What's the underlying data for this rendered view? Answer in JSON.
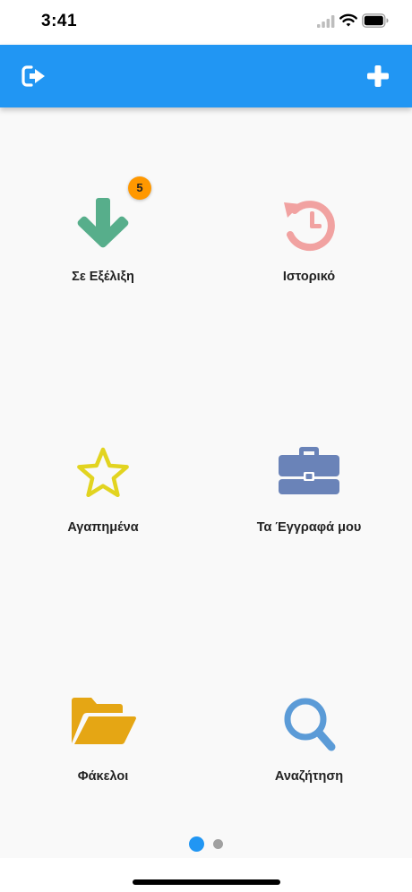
{
  "status_bar": {
    "time": "3:41"
  },
  "app_bar": {
    "background_color": "#2196f3",
    "left_icon": "logout-icon",
    "right_icon": "plus-icon"
  },
  "tiles": [
    {
      "label": "Σε Εξέλιξη",
      "icon": "arrow-down-icon",
      "color": "#57ae8b",
      "badge": "5"
    },
    {
      "label": "Ιστορικό",
      "icon": "history-icon",
      "color": "#f1a2a1"
    },
    {
      "label": "Αγαπημένα",
      "icon": "star-icon",
      "color": "#e2d420"
    },
    {
      "label": "Τα Έγγραφά μου",
      "icon": "briefcase-icon",
      "color": "#6a83b8"
    },
    {
      "label": "Φάκελοι",
      "icon": "folder-open-icon",
      "color": "#e5a614"
    },
    {
      "label": "Αναζήτηση",
      "icon": "search-icon",
      "color": "#5b9bd7"
    }
  ],
  "badge_color": "#ff9800",
  "pagination": {
    "active_color": "#2196f3",
    "inactive_color": "#a0a0a0"
  }
}
